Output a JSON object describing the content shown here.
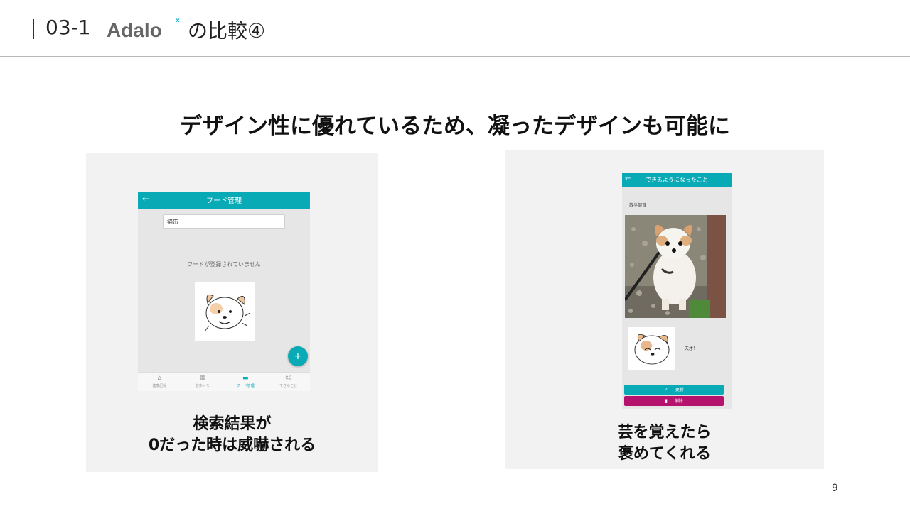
{
  "header": {
    "section_number": "03-1",
    "logo_text": "Adalo",
    "title_suffix": "の比較④"
  },
  "headline": "デザイン性に優れているため、凝ったデザインも可能に",
  "left_example": {
    "app": {
      "title": "フード管理",
      "back_icon": "arrow-left-icon",
      "search_value": "猫缶",
      "empty_message": "フードが登録されていません",
      "image": "dog-illustration",
      "fab_label": "+",
      "nav": [
        {
          "icon": "home-icon",
          "label": "健康記録",
          "active": false
        },
        {
          "icon": "calendar-icon",
          "label": "散歩メモ",
          "active": false
        },
        {
          "icon": "store-icon",
          "label": "フード管理",
          "active": true
        },
        {
          "icon": "smile-icon",
          "label": "できること",
          "active": false
        }
      ]
    },
    "caption_line1": "検索結果が",
    "caption_line2": "0だった時は威嚇される"
  },
  "right_example": {
    "app": {
      "title": "できるようになったこと",
      "back_icon": "arrow-left-icon",
      "item_label": "散歩部首",
      "photo": "dog-photo",
      "thumb": "dog-illustration",
      "thumb_text": "天才！",
      "update_label": "更新",
      "delete_label": "削除"
    },
    "caption_line1": "芸を覚えたら",
    "caption_line2": "褒めてくれる"
  },
  "page_number": "9",
  "colors": {
    "accent": "#08aab6",
    "danger": "#b5126d",
    "panel_bg": "#f2f2f2"
  }
}
